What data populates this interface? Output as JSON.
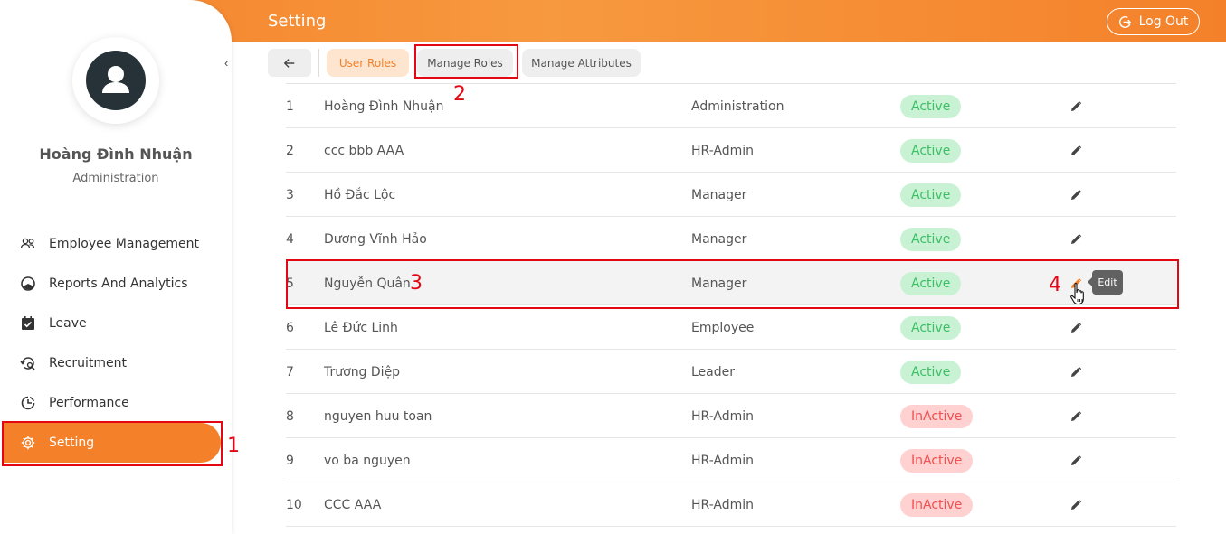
{
  "header": {
    "title": "Setting",
    "logout_label": "Log Out",
    "accent_color": "#f4812a"
  },
  "sidebar": {
    "user_name": "Hoàng Đình Nhuận",
    "user_role": "Administration",
    "items": [
      {
        "label": "Employee Management",
        "icon": "users-icon"
      },
      {
        "label": "Reports And Analytics",
        "icon": "chart-pie-icon"
      },
      {
        "label": "Leave",
        "icon": "calendar-check-icon"
      },
      {
        "label": "Recruitment",
        "icon": "recruit-icon"
      },
      {
        "label": "Performance",
        "icon": "performance-icon"
      },
      {
        "label": "Setting",
        "icon": "gear-icon",
        "active": true
      }
    ]
  },
  "tabs": {
    "user_roles": "User Roles",
    "manage_roles": "Manage Roles",
    "manage_attributes": "Manage Attributes"
  },
  "table": {
    "rows": [
      {
        "no": "1",
        "name": "Hoàng Đình Nhuận",
        "role": "Administration",
        "status": "Active"
      },
      {
        "no": "2",
        "name": "ccc bbb AAA",
        "role": "HR-Admin",
        "status": "Active"
      },
      {
        "no": "3",
        "name": "Hồ Đắc Lộc",
        "role": "Manager",
        "status": "Active"
      },
      {
        "no": "4",
        "name": "Dương Vĩnh Hảo",
        "role": "Manager",
        "status": "Active"
      },
      {
        "no": "5",
        "name": "Nguyễn Quân",
        "role": "Manager",
        "status": "Active"
      },
      {
        "no": "6",
        "name": "Lê Đức Linh",
        "role": "Employee",
        "status": "Active"
      },
      {
        "no": "7",
        "name": "Trương Diệp",
        "role": "Leader",
        "status": "Active"
      },
      {
        "no": "8",
        "name": "nguyen huu toan",
        "role": "HR-Admin",
        "status": "InActive"
      },
      {
        "no": "9",
        "name": "vo ba nguyen",
        "role": "HR-Admin",
        "status": "InActive"
      },
      {
        "no": "10",
        "name": "CCC AAA",
        "role": "HR-Admin",
        "status": "InActive"
      }
    ],
    "edit_tooltip": "Edit"
  },
  "annotations": {
    "a1": "1",
    "a2": "2",
    "a3": "3",
    "a4": "4"
  }
}
